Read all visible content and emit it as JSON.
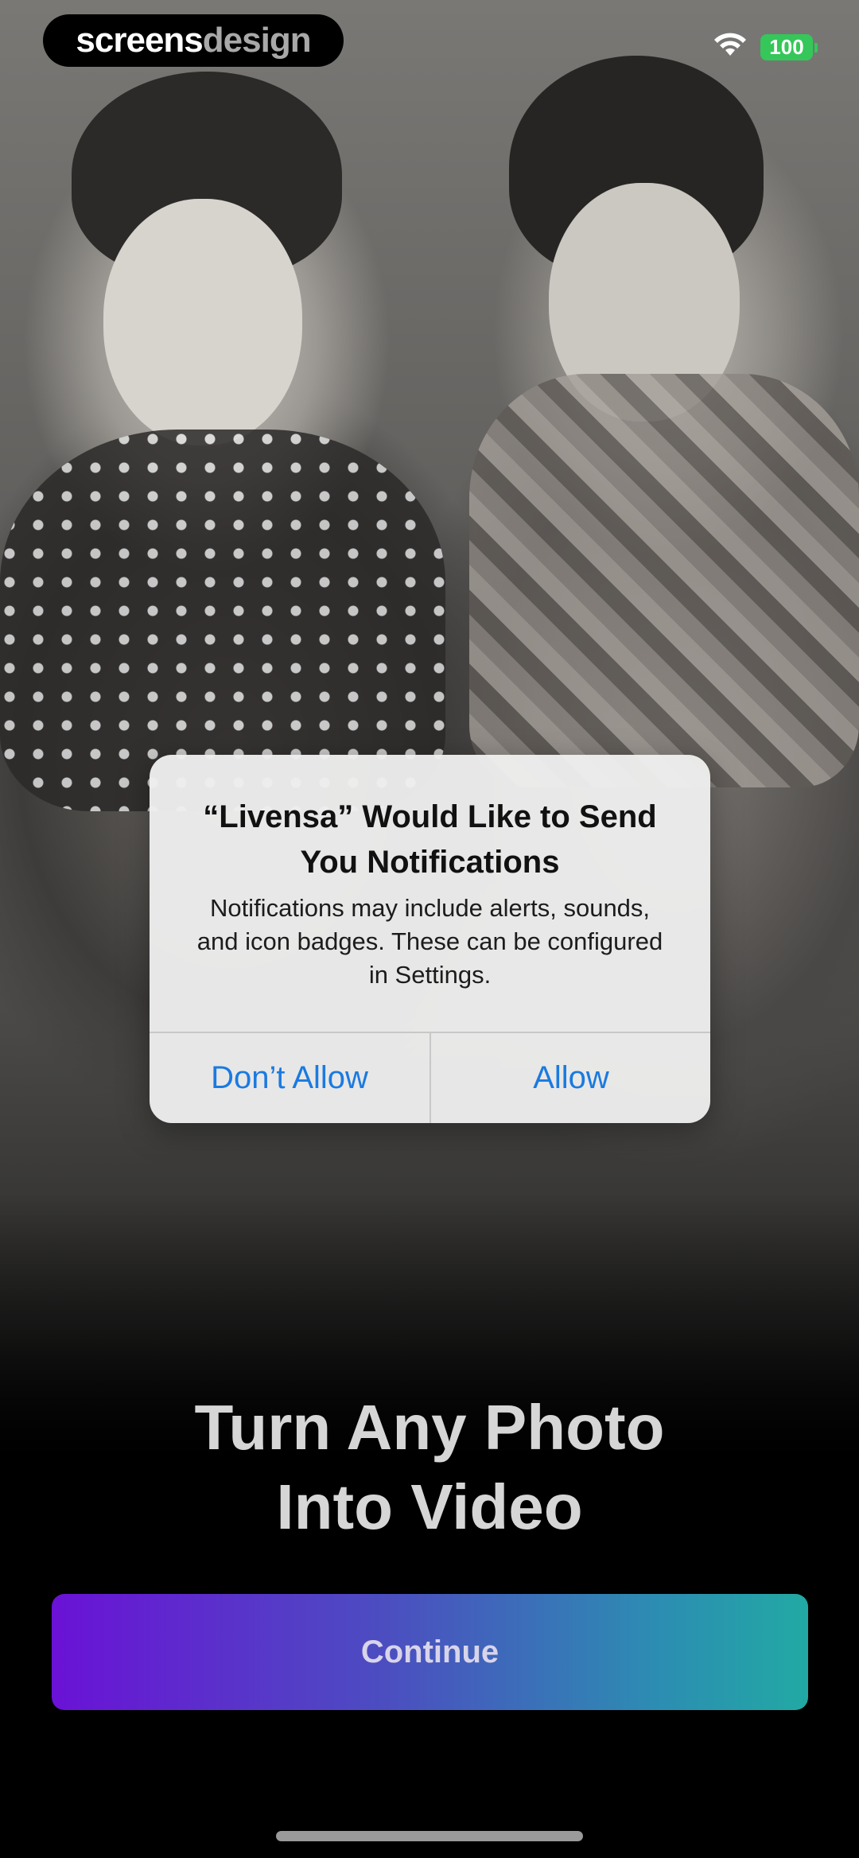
{
  "brand": {
    "part1": "screens",
    "part2": "design"
  },
  "status": {
    "battery": "100"
  },
  "alert": {
    "title": "“Livensa” Would Like to Send You Notifications",
    "message": "Notifications may include alerts, sounds, and icon badges. These can be configured in Settings.",
    "deny_label": "Don’t Allow",
    "allow_label": "Allow"
  },
  "onboarding": {
    "headline_line1": "Turn Any Photo",
    "headline_line2": "Into Video",
    "continue_label": "Continue"
  },
  "colors": {
    "alert_button_blue": "#1a7ae0",
    "cta_gradient_start": "#6a12d6",
    "cta_gradient_end": "#22a9a4",
    "battery_green": "#35c759"
  }
}
